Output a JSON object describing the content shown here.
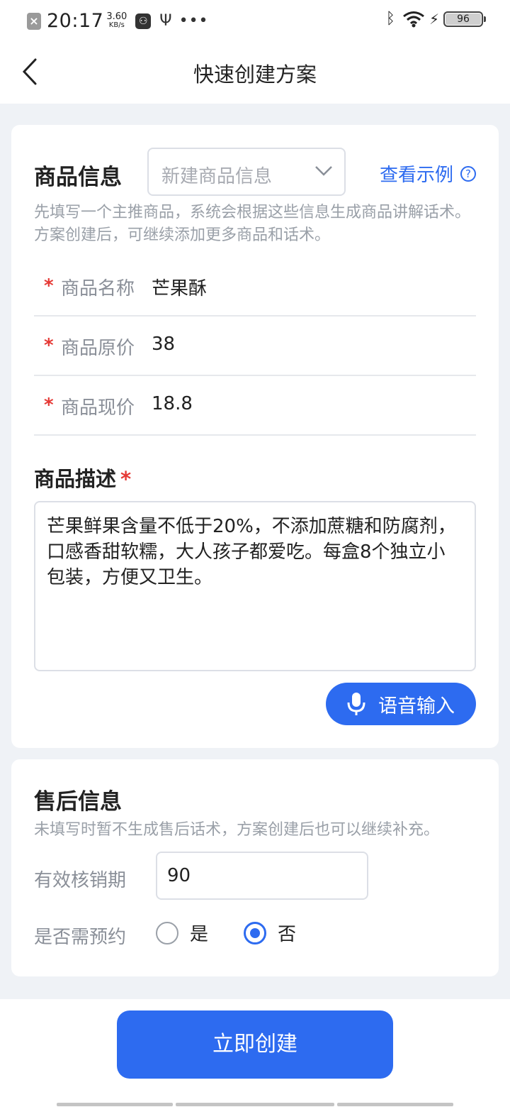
{
  "status_bar": {
    "time": "20:17",
    "net_speed_value": "3.60",
    "net_speed_unit": "KB/s",
    "battery": "96",
    "icons": [
      "x-notification-icon",
      "usb-debug-icon",
      "usb-icon",
      "more-dots-icon",
      "bluetooth-icon",
      "wifi-icon",
      "charging-icon",
      "battery-icon"
    ]
  },
  "header": {
    "title": "快速创建方案"
  },
  "product_info": {
    "title": "商品信息",
    "select_placeholder": "新建商品信息",
    "example_link": "查看示例",
    "hint": "先填写一个主推商品，系统会根据这些信息生成商品讲解话术。方案创建后，可继续添加更多商品和话术。",
    "fields": [
      {
        "label": "商品名称",
        "value": "芒果酥"
      },
      {
        "label": "商品原价",
        "value": "38"
      },
      {
        "label": "商品现价",
        "value": "18.8"
      }
    ],
    "required_mark": "*",
    "description_title": "商品描述",
    "description": "芒果鲜果含量不低于20%，不添加蔗糖和防腐剂，口感香甜软糯，大人孩子都爱吃。每盒8个独立小包装，方便又卫生。",
    "voice_button": "语音输入"
  },
  "after_sales": {
    "title": "售后信息",
    "hint": "未填写时暂不生成售后话术，方案创建后也可以继续补充。",
    "validity_label": "有效核销期",
    "validity_value": "90",
    "reservation_label": "是否需预约",
    "options": [
      "是",
      "否"
    ],
    "selected": "否"
  },
  "footer": {
    "create_button": "立即创建"
  },
  "colors": {
    "accent": "#2d6bf0",
    "required": "#e53935",
    "background": "#eff2f6"
  }
}
